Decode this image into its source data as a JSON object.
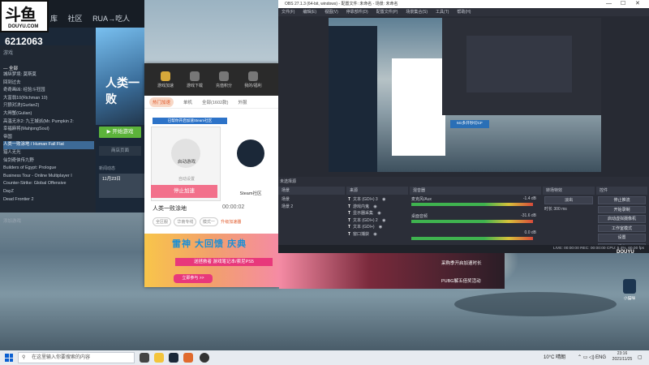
{
  "stream": {
    "logo_text": "斗鱼",
    "logo_sub": "DOUYU.COM",
    "room_number": "6212063"
  },
  "steam": {
    "nav": [
      "库",
      "社区",
      "RUA→吃人"
    ],
    "side_header": "游戏",
    "all_label": "— 全部",
    "games": [
      "城纵梦境: 莫斯莫",
      "回到过去",
      "奇奇画凶: 经验斗狂园",
      "大富翁10(Richman 10)",
      "只狼对决(Gurlan2)",
      "大闸蟹(Gulian)",
      "高温无水2: 九王城派(Mr. Pumpkin 2:",
      "幸福麻将(MahjongSoul)",
      "帝国",
      "人类一败涂地 / Human Fall Flat",
      "猎人无光",
      "仙剑奇侠传九野",
      "Builders of Egypt: Prologue",
      "Business Tour - Online Multiplayer I",
      "Counter-Strike: Global Offensive",
      "DayZ",
      "Dead Frontier 2"
    ],
    "selected_index": 9,
    "hero_title": "人类一败",
    "play_label": "开始游戏",
    "store_label": "商店页面",
    "date_label": "11月23日",
    "news_label": "新闻动态",
    "add_game": "添加游戏"
  },
  "booster": {
    "tabs": [
      "游戏加速",
      "游戏下载",
      "充值积分",
      "我的/福利"
    ],
    "categories": [
      "热门加速",
      "单机",
      "全部(1602款)",
      "外服"
    ],
    "note": "已帮你开启加速Steam社区",
    "card1_label": "启动游戏",
    "card1_sub": "自动设置",
    "card2_label": "Steam社区",
    "stop_label": "停止加速",
    "game_name": "人类一败涂地",
    "timer": "00:00:02",
    "options": [
      "全区服",
      "华南专线",
      "模式一"
    ],
    "upgrade": "升级加速器",
    "banner_title": "雷神 大回馈 庆典",
    "banner_sub": "送拯救者 游戏笔记本/索尼PS5",
    "banner_btn": "立即参与 >>",
    "promo1": "采购季开启加速时长",
    "promo2": "PUBG解五倍奖活动"
  },
  "obs": {
    "title": "OBS 27.1.3 (64-bit, windows) - 配置文件: 未命名 - 场景: 未命名",
    "menu": [
      "文件(F)",
      "编辑(E)",
      "视图(V)",
      "停靠部件(D)",
      "配置文件(P)",
      "场景集合(S)",
      "工具(T)",
      "帮助(H)"
    ],
    "docks": {
      "scenes_hd": "场景",
      "sources_hd": "来源",
      "mixer_hd": "混音器",
      "transitions_hd": "转场特效",
      "controls_hd": "控件"
    },
    "preview_label": "未选择源",
    "scenes": [
      "场景",
      "场景 2"
    ],
    "sources": [
      "文本 (GDI+) 3",
      "游戏内鬼",
      "显示器采集",
      "文本 (GDI+) 2",
      "文本 (GDI+)",
      "窗口捕获"
    ],
    "mixer": [
      {
        "name": "麦克风/Aux",
        "db": "-1.4 dB"
      },
      {
        "name": "桌面音频",
        "db": "-31.6 dB"
      },
      {
        "name": "",
        "db": "0.0 dB"
      }
    ],
    "transition": "淡出",
    "duration_label": "时长",
    "duration_value": "300 ms",
    "controls": [
      "停止推流",
      "开始录制",
      "启动虚拟摄像机",
      "工作室模式",
      "设置",
      "退出"
    ],
    "status": "LIVE: 00:00:00   REC: 00:00:00   CPU: 5.4%, 60.00 fps",
    "preview_tag": "5G多开秒切CF"
  },
  "desktop": {
    "icon_label": "小猫咪",
    "logo": "DOUYU"
  },
  "taskbar": {
    "search_placeholder": "在这里输入你要搜索的内容",
    "weather": "10°C 晴朗",
    "lang": "ENG",
    "time": "23:16",
    "date": "2021/11/25"
  }
}
